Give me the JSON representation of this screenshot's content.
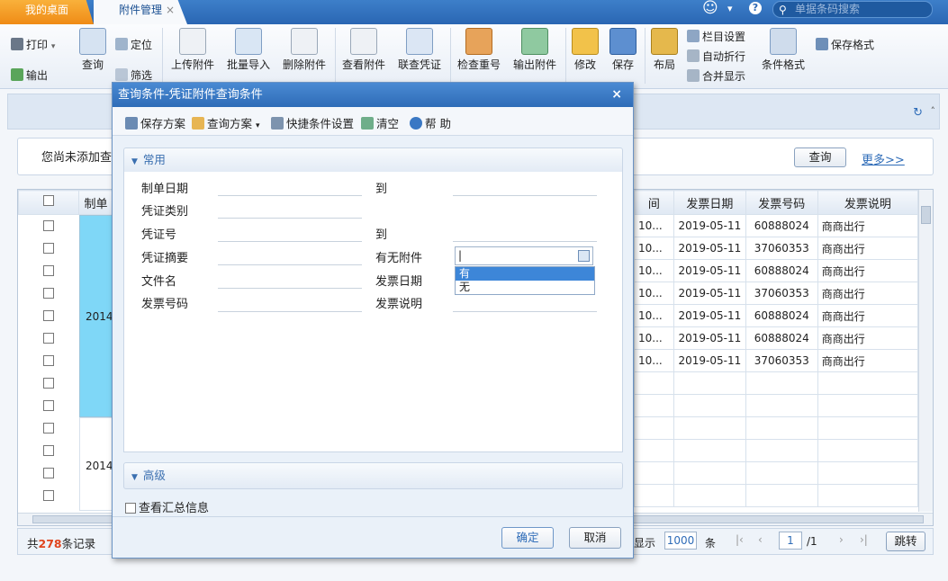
{
  "tabs": {
    "desk": "我的桌面",
    "attachments": "附件管理",
    "close": "×"
  },
  "search": {
    "placeholder": "单据条码搜索"
  },
  "top_icons": {
    "smile": "☺",
    "caret": "▾",
    "help": "?"
  },
  "toolbar": {
    "print": "打印",
    "output": "输出",
    "query": "查询",
    "locate": "定位",
    "filter": "筛选",
    "upload": "上传附件",
    "batch_import": "批量导入",
    "delete": "删除附件",
    "view": "查看附件",
    "link_voucher": "联查凭证",
    "check_dup": "检查重号",
    "export": "输出附件",
    "edit": "修改",
    "save": "保存",
    "layout": "布局",
    "col_settings": "栏目设置",
    "auto_wrap": "自动折行",
    "merge_display": "合并显示",
    "cond_format": "条件格式",
    "save_format": "保存格式"
  },
  "query_panel": {
    "hint": "您尚未添加查询",
    "query_btn": "查询",
    "more": "更多>>"
  },
  "grid": {
    "left_headers": [
      "制单"
    ],
    "right_headers": [
      "间",
      "发票日期",
      "发票号码",
      "发票说明"
    ],
    "left_col_groups": [
      "2014-",
      "2014-"
    ],
    "rows": [
      [
        "10...",
        "2019-05-11",
        "60888024",
        "商商出行"
      ],
      [
        "10...",
        "2019-05-11",
        "37060353",
        "商商出行"
      ],
      [
        "10...",
        "2019-05-11",
        "60888024",
        "商商出行"
      ],
      [
        "10...",
        "2019-05-11",
        "37060353",
        "商商出行"
      ],
      [
        "10...",
        "2019-05-11",
        "60888024",
        "商商出行"
      ],
      [
        "10...",
        "2019-05-11",
        "60888024",
        "商商出行"
      ],
      [
        "10...",
        "2019-05-11",
        "37060353",
        "商商出行"
      ]
    ]
  },
  "footer": {
    "total_prefix": "共",
    "total": "278",
    "total_suffix": "条记录",
    "show": "显示",
    "page_size": "1000",
    "unit": "条",
    "page": "1",
    "page_total": "/1",
    "jump": "跳转"
  },
  "dialog": {
    "title": "查询条件-凭证附件查询条件",
    "close": "×",
    "toolbar": {
      "save_plan": "保存方案",
      "query_plan": "查询方案",
      "quick_settings": "快捷条件设置",
      "clear": "清空",
      "help": "帮 助"
    },
    "section_common": "常用",
    "fields": {
      "date": "制单日期",
      "date_to": "到",
      "voucher_type": "凭证类别",
      "voucher_no": "凭证号",
      "voucher_no_to": "到",
      "summary": "凭证摘要",
      "has_attach": "有无附件",
      "file_name": "文件名",
      "invoice_date": "发票日期",
      "invoice_no": "发票号码",
      "invoice_desc": "发票说明"
    },
    "dropdown_options": [
      "有",
      "无"
    ],
    "section_advanced": "高级",
    "summary_checkbox": "查看汇总信息",
    "ok": "确定",
    "cancel": "取消"
  },
  "colors": {
    "accent": "#2e6cb8",
    "tab_active": "#f0921b",
    "selected_row": "#7fd7f7"
  }
}
